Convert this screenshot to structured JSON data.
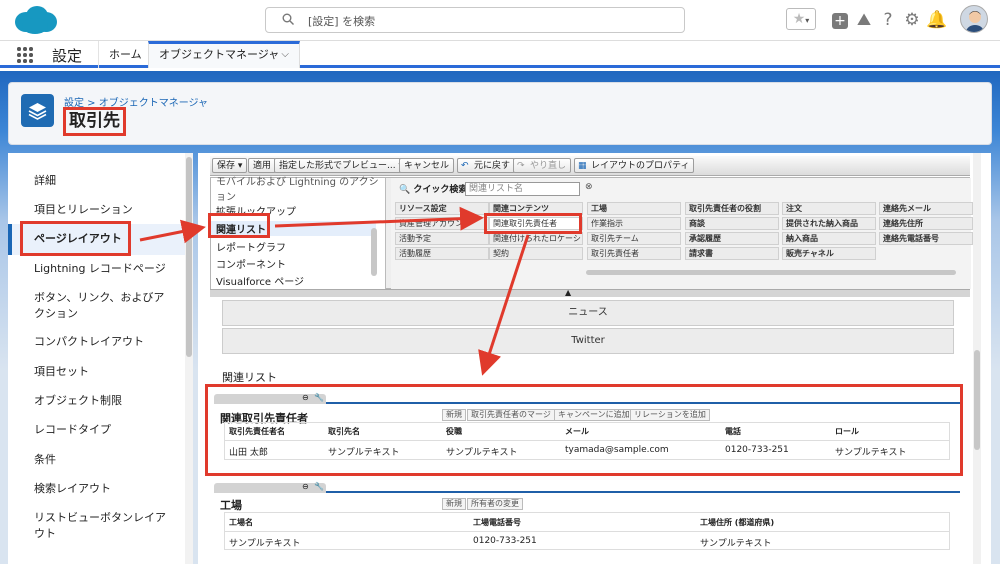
{
  "top": {
    "search_placeholder": "[設定] を検索",
    "icons": [
      "star-icon",
      "dropdown-icon",
      "add-icon",
      "trailhead-icon",
      "help-icon",
      "gear-icon",
      "bell-icon",
      "user-avatar-icon"
    ]
  },
  "nav": {
    "app_title": "設定",
    "home_tab": "ホーム",
    "object_manager_tab": "オブジェクトマネージャ"
  },
  "header": {
    "breadcrumb": "設定 > オブジェクトマネージャ",
    "title": "取引先"
  },
  "sidebar": {
    "items": [
      {
        "label": "詳細"
      },
      {
        "label": "項目とリレーション"
      },
      {
        "label": "ページレイアウト"
      },
      {
        "label": "Lightning レコードページ"
      },
      {
        "label": "ボタン、リンク、およびアクション"
      },
      {
        "label": "コンパクトレイアウト"
      },
      {
        "label": "項目セット"
      },
      {
        "label": "オブジェクト制限"
      },
      {
        "label": "レコードタイプ"
      },
      {
        "label": "条件"
      },
      {
        "label": "検索レイアウト"
      },
      {
        "label": "リストビューボタンレイアウト"
      }
    ]
  },
  "toolbar": {
    "save": "保存 ▾",
    "apply": "適用",
    "preview": "指定した形式でプレビュー... ▾",
    "cancel": "キャンセル",
    "undo": "元に戻す",
    "redo": "やり直し",
    "properties": "レイアウトのプロパティ"
  },
  "palette": {
    "list": [
      "モバイルおよび Lightning のアクション",
      "拡張ルックアップ",
      "関連リスト",
      "レポートグラフ",
      "コンポーネント",
      "Visualforce ページ"
    ],
    "quick_search_label": "クイック検索",
    "quick_search_placeholder": "関連リスト名",
    "cells": [
      [
        "リソース設定",
        "関連コンテンツ",
        "工場",
        "取引先責任者の役割",
        "注文",
        "連絡先メール"
      ],
      [
        "資産管理アカウント",
        "関連取引先責任者",
        "作業指示",
        "商談",
        "提供された納入商品",
        "連絡先住所"
      ],
      [
        "活動予定",
        "関連付けられたロケーション",
        "取引先チーム",
        "承認履歴",
        "納入商品",
        "連絡先電話番号"
      ],
      [
        "活動履歴",
        "契約",
        "取引先責任者",
        "請求書",
        "販売チャネル",
        ""
      ]
    ]
  },
  "layout": {
    "sections": [
      "ニュース",
      "Twitter"
    ],
    "related_list_title": "関連リスト",
    "related_contacts": {
      "name": "関連取引先責任者",
      "buttons": [
        "新規",
        "取引先責任者のマージ",
        "キャンペーンに追加",
        "リレーションを追加"
      ],
      "headers": [
        "取引先責任者名",
        "取引先名",
        "役職",
        "メール",
        "電話",
        "ロール"
      ],
      "row": [
        "山田 太郎",
        "サンプルテキスト",
        "サンプルテキスト",
        "tyamada@sample.com",
        "0120-733-251",
        "サンプルテキスト"
      ]
    },
    "factory": {
      "name": "工場",
      "buttons": [
        "新規",
        "所有者の変更"
      ],
      "headers": [
        "工場名",
        "工場電話番号",
        "工場住所 (都道府県)"
      ],
      "row": [
        "サンプルテキスト",
        "0120-733-251",
        "サンプルテキスト"
      ]
    }
  },
  "colors": {
    "brand_blue": "#1a66b5",
    "highlight_red": "#e03a2c"
  }
}
